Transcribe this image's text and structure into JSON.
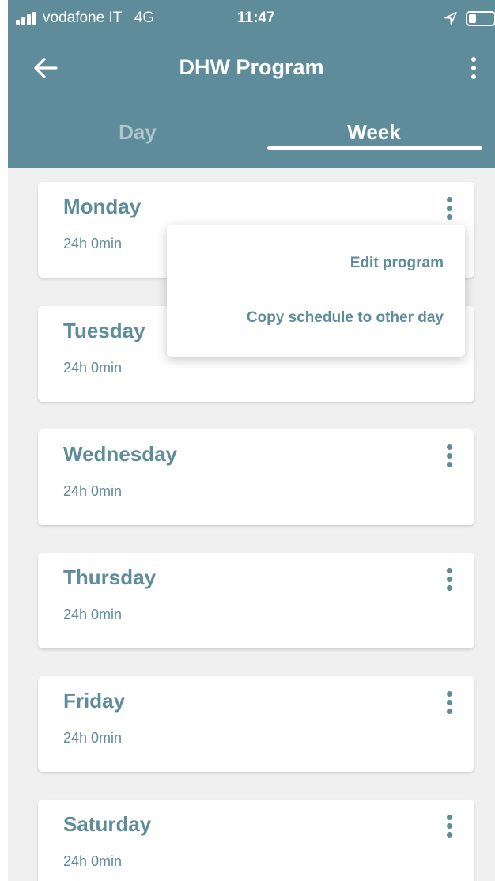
{
  "status_bar": {
    "carrier": "vodafone IT   4G",
    "time": "11:47"
  },
  "header": {
    "title": "DHW Program",
    "back_icon": "arrow-left-icon",
    "menu_icon": "more-vertical-icon"
  },
  "tabs": [
    {
      "label": "Day",
      "selected": false
    },
    {
      "label": "Week",
      "selected": true
    }
  ],
  "days": [
    {
      "name": "Monday",
      "duration": "24h 0min"
    },
    {
      "name": "Tuesday",
      "duration": "24h 0min"
    },
    {
      "name": "Wednesday",
      "duration": "24h 0min"
    },
    {
      "name": "Thursday",
      "duration": "24h 0min"
    },
    {
      "name": "Friday",
      "duration": "24h 0min"
    },
    {
      "name": "Saturday",
      "duration": "24h 0min"
    }
  ],
  "popup_menu": {
    "items": [
      "Edit program",
      "Copy schedule to other day"
    ]
  },
  "colors": {
    "accent": "#5f8c9a",
    "background": "#f0f0f0",
    "card": "#ffffff"
  }
}
